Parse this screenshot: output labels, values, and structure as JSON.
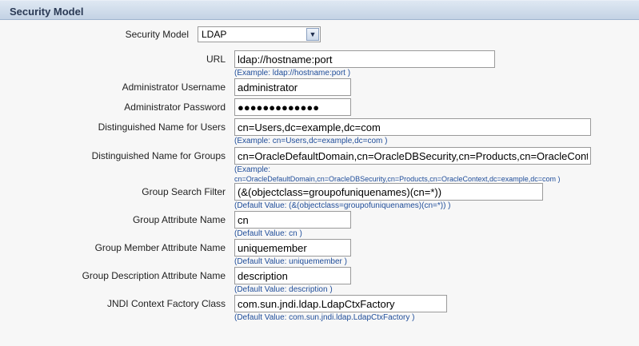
{
  "section": {
    "title": "Security Model"
  },
  "security_model": {
    "label": "Security Model",
    "selected": "LDAP"
  },
  "fields": {
    "url": {
      "label": "URL",
      "value": "ldap://hostname:port",
      "hint": "(Example: ldap://hostname:port )"
    },
    "admin_username": {
      "label": "Administrator Username",
      "value": "administrator"
    },
    "admin_password": {
      "label": "Administrator Password",
      "value": "●●●●●●●●●●●●●"
    },
    "dn_users": {
      "label": "Distinguished Name for Users",
      "value": "cn=Users,dc=example,dc=com",
      "hint": "(Example: cn=Users,dc=example,dc=com )"
    },
    "dn_groups": {
      "label": "Distinguished Name for Groups",
      "value": "cn=OracleDefaultDomain,cn=OracleDBSecurity,cn=Products,cn=OracleContext,dc=example,dc=com",
      "hint_line1": "(Example:",
      "hint_line2": "cn=OracleDefaultDomain,cn=OracleDBSecurity,cn=Products,cn=OracleContext,dc=example,dc=com )"
    },
    "group_search_filter": {
      "label": "Group Search Filter",
      "value": "(&(objectclass=groupofuniquenames)(cn=*))",
      "hint": "(Default Value: (&(objectclass=groupofuniquenames)(cn=*)) )"
    },
    "group_attribute_name": {
      "label": "Group Attribute Name",
      "value": "cn",
      "hint": "(Default Value: cn )"
    },
    "group_member_attribute_name": {
      "label": "Group Member Attribute Name",
      "value": "uniquemember",
      "hint": "(Default Value: uniquemember )"
    },
    "group_description_attribute_name": {
      "label": "Group Description Attribute Name",
      "value": "description",
      "hint": "(Default Value: description )"
    },
    "jndi_context_factory_class": {
      "label": "JNDI Context Factory Class",
      "value": "com.sun.jndi.ldap.LdapCtxFactory",
      "hint": "(Default Value: com.sun.jndi.ldap.LdapCtxFactory )"
    }
  }
}
